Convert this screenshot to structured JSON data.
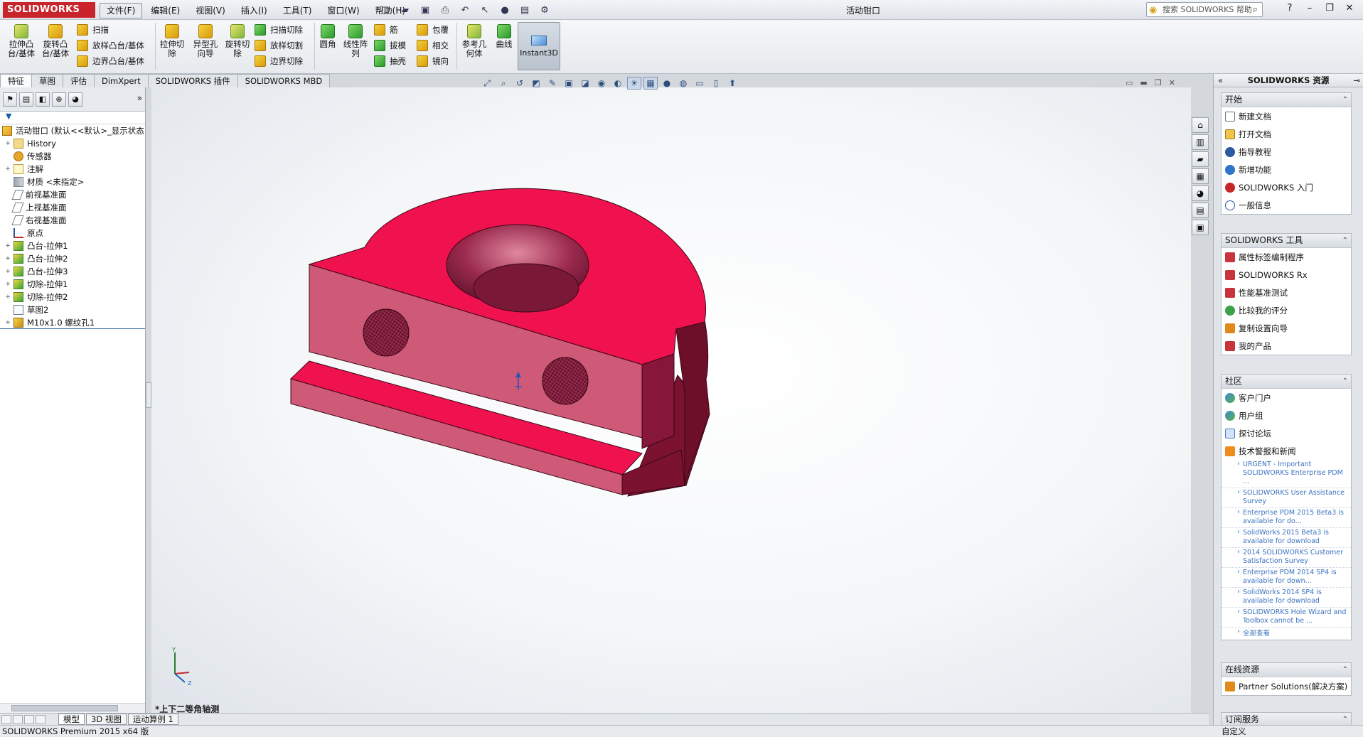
{
  "app": {
    "logo": "SOLIDWORKS",
    "doc_title": "活动钳口",
    "help_search_placeholder": "搜索 SOLIDWORKS 帮助"
  },
  "menu": [
    "文件(F)",
    "编辑(E)",
    "视图(V)",
    "插入(I)",
    "工具(T)",
    "窗口(W)",
    "帮助(H)"
  ],
  "commands": {
    "extrude_boss": "拉伸凸\n台/基体",
    "revolve_boss": "旋转凸\n台/基体",
    "sweep": "扫描",
    "loft_boss": "放样凸台/基体",
    "boundary_boss": "边界凸台/基体",
    "extrude_cut": "拉伸切\n除",
    "hole_wizard": "异型孔\n向导",
    "revolve_cut": "旋转切\n除",
    "sweep_cut": "扫描切除",
    "loft_cut": "放样切割",
    "boundary_cut": "边界切除",
    "fillet": "圆角",
    "linear_pattern": "线性阵\n列",
    "rib": "筋",
    "draft": "拔模",
    "shell": "抽壳",
    "wrap": "包覆",
    "intersect": "相交",
    "mirror": "镜向",
    "ref_geometry": "参考几\n何体",
    "curves": "曲线",
    "instant3d": "Instant3D"
  },
  "tabs": [
    "特征",
    "草图",
    "评估",
    "DimXpert",
    "SOLIDWORKS 插件",
    "SOLIDWORKS MBD"
  ],
  "feature_tree": {
    "root": "活动钳口 (默认<<默认>_显示状态",
    "items": [
      {
        "label": "History",
        "icon": "folder",
        "expand": "+"
      },
      {
        "label": "传感器",
        "icon": "sensor",
        "expand": ""
      },
      {
        "label": "注解",
        "icon": "annot",
        "expand": "+"
      },
      {
        "label": "材质 <未指定>",
        "icon": "mat",
        "expand": ""
      },
      {
        "label": "前视基准面",
        "icon": "plane",
        "expand": ""
      },
      {
        "label": "上视基准面",
        "icon": "plane",
        "expand": ""
      },
      {
        "label": "右视基准面",
        "icon": "plane",
        "expand": ""
      },
      {
        "label": "原点",
        "icon": "origin",
        "expand": ""
      },
      {
        "label": "凸台-拉伸1",
        "icon": "feat",
        "expand": "+"
      },
      {
        "label": "凸台-拉伸2",
        "icon": "feat",
        "expand": "+"
      },
      {
        "label": "凸台-拉伸3",
        "icon": "feat",
        "expand": "+"
      },
      {
        "label": "切除-拉伸1",
        "icon": "feat",
        "expand": "+"
      },
      {
        "label": "切除-拉伸2",
        "icon": "feat",
        "expand": "+"
      },
      {
        "label": "草图2",
        "icon": "sketch",
        "expand": ""
      },
      {
        "label": "M10x1.0 螺纹孔1",
        "icon": "hole",
        "expand": "+"
      }
    ]
  },
  "viewport": {
    "view_label": "*上下二等角轴测",
    "part_colors": {
      "top": "#f0124f",
      "front": "#cf5a78",
      "side": "#7a1230",
      "bore": "#8c2346"
    }
  },
  "bottom_tabs": [
    "模型",
    "3D 视图",
    "运动算例 1"
  ],
  "status": {
    "left": "SOLIDWORKS Premium 2015 x64 版",
    "right": "自定义"
  },
  "resources": {
    "title": "SOLIDWORKS 资源",
    "start": {
      "title": "开始",
      "items": [
        {
          "label": "新建文档",
          "icon": "doc"
        },
        {
          "label": "打开文档",
          "icon": "open"
        },
        {
          "label": "指导教程",
          "icon": "tut"
        },
        {
          "label": "新增功能",
          "icon": "q"
        },
        {
          "label": "SOLIDWORKS 入门",
          "icon": "sw"
        },
        {
          "label": "一般信息",
          "icon": "info"
        }
      ]
    },
    "tools": {
      "title": "SOLIDWORKS 工具",
      "items": [
        {
          "label": "属性标签编制程序",
          "icon": "red"
        },
        {
          "label": "SOLIDWORKS Rx",
          "icon": "red"
        },
        {
          "label": "性能基准测试",
          "icon": "red"
        },
        {
          "label": "比较我的评分",
          "icon": "green"
        },
        {
          "label": "复制设置向导",
          "icon": "orange"
        },
        {
          "label": "我的产品",
          "icon": "red"
        }
      ]
    },
    "community": {
      "title": "社区",
      "items": [
        {
          "label": "客户门户",
          "icon": "globe"
        },
        {
          "label": "用户组",
          "icon": "globe"
        },
        {
          "label": "探讨论坛",
          "icon": "chat"
        },
        {
          "label": "技术警报和新闻",
          "icon": "rss"
        }
      ],
      "news": [
        "URGENT - Important SOLIDWORKS Enterprise PDM ...",
        "SOLIDWORKS User Assistance Survey",
        "Enterprise PDM 2015 Beta3 is available for do...",
        "SolidWorks 2015 Beta3 is available for download",
        "2014 SOLIDWORKS Customer Satisfaction Survey",
        "Enterprise PDM 2014 SP4 is available for down...",
        "SolidWorks 2014 SP4 is available for download",
        "SOLIDWORKS Hole Wizard and Toolbox cannot be ..."
      ],
      "more": "全部查看"
    },
    "online": {
      "title": "在线资源",
      "items": [
        {
          "label": "Partner Solutions(解决方案)",
          "icon": "orange"
        }
      ]
    },
    "subscription": {
      "title": "订阅服务"
    }
  }
}
